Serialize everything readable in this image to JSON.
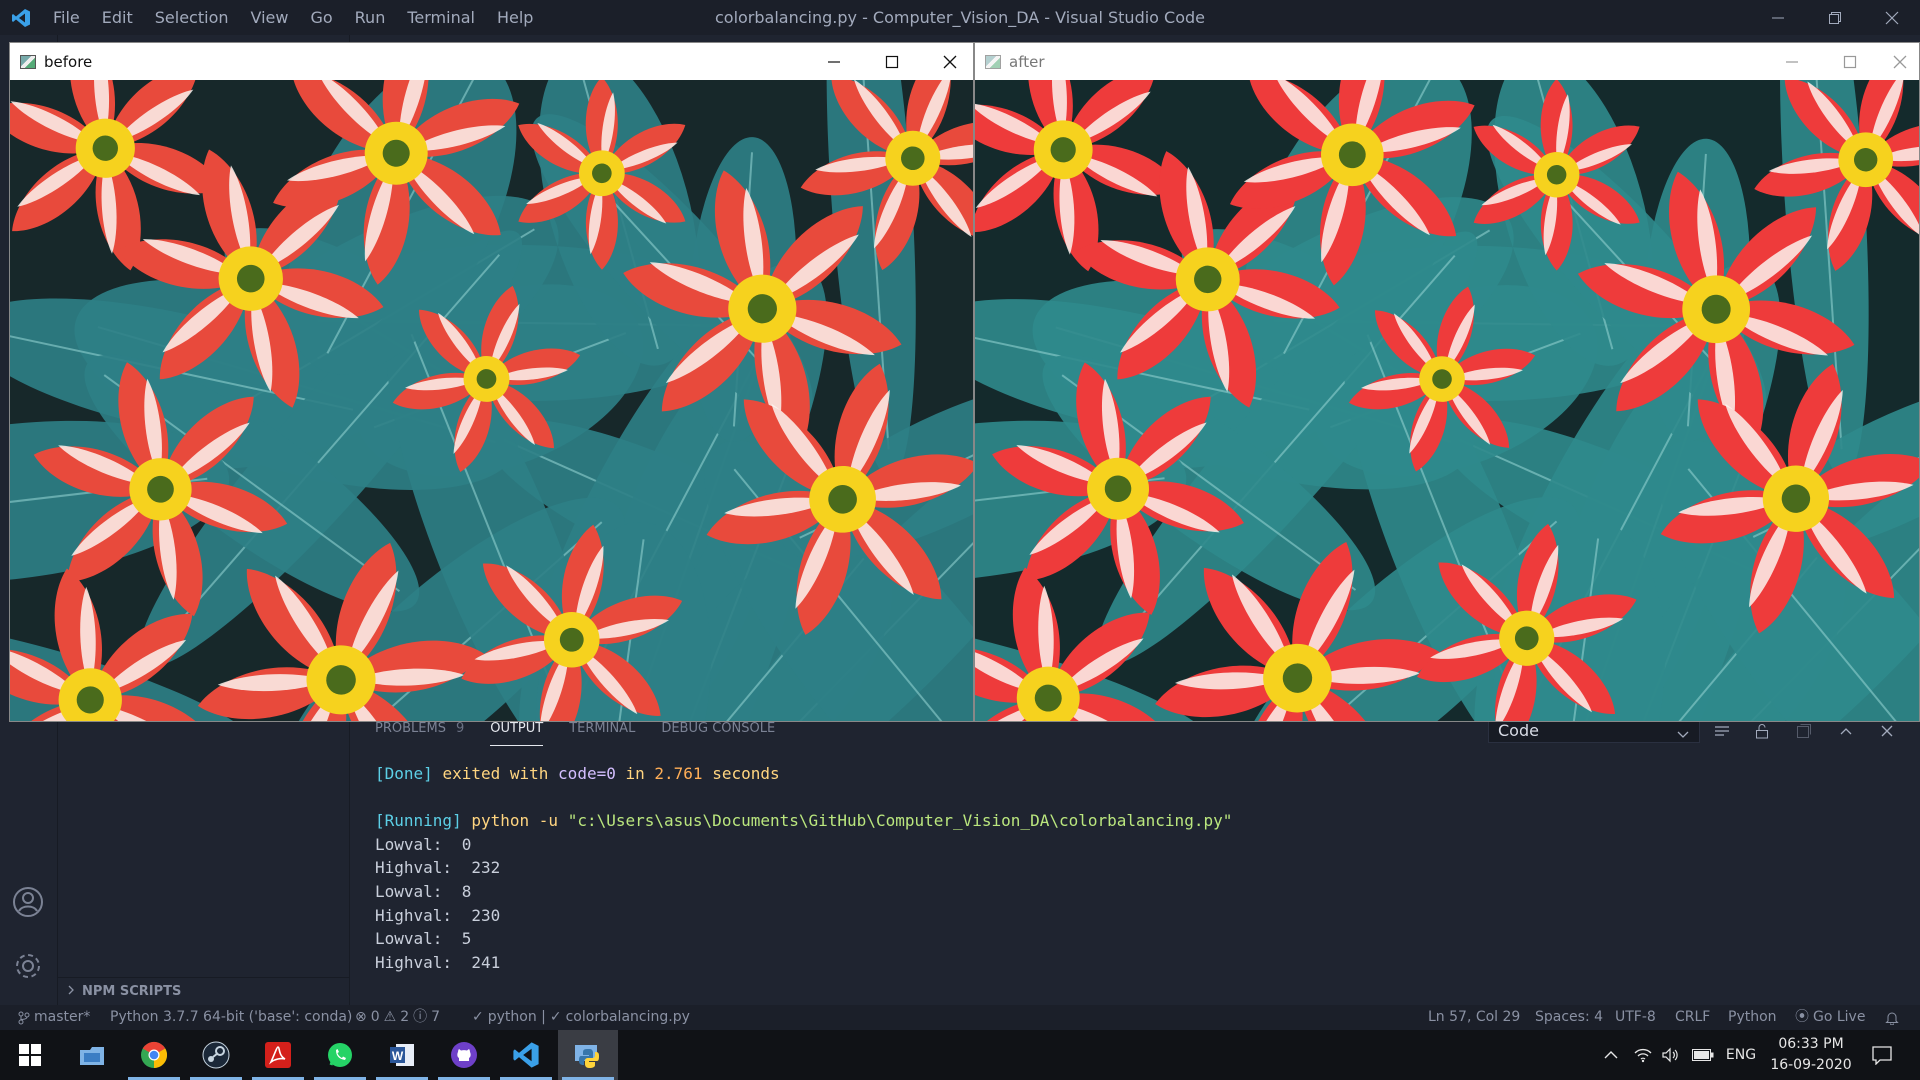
{
  "titlebar": {
    "menu": [
      "File",
      "Edit",
      "Selection",
      "View",
      "Go",
      "Run",
      "Terminal",
      "Help"
    ],
    "title": "colorbalancing.py - Computer_Vision_DA - Visual Studio Code"
  },
  "windows": {
    "before": {
      "title": "before"
    },
    "after": {
      "title": "after"
    }
  },
  "sidebar": {
    "npm_scripts": "NPM SCRIPTS"
  },
  "panel": {
    "tabs": [
      {
        "label": "PROBLEMS",
        "badge": "9"
      },
      {
        "label": "OUTPUT"
      },
      {
        "label": "TERMINAL"
      },
      {
        "label": "DEBUG CONSOLE"
      }
    ],
    "output_channel": "Code",
    "output": {
      "done_tag": "[Done]",
      "done_text": "exited with",
      "done_code": "code=0",
      "done_in": "in",
      "done_time": "2.761",
      "done_unit": "seconds",
      "running_tag": "[Running]",
      "running_cmd": "python -u",
      "running_path": "\"c:\\Users\\asus\\Documents\\GitHub\\Computer_Vision_DA\\colorbalancing.py\"",
      "lines": [
        {
          "label": "Lowval:",
          "value": "0"
        },
        {
          "label": "Highval:",
          "value": "232"
        },
        {
          "label": "Lowval:",
          "value": "8"
        },
        {
          "label": "Highval:",
          "value": "230"
        },
        {
          "label": "Lowval:",
          "value": "5"
        },
        {
          "label": "Highval:",
          "value": "241"
        }
      ]
    }
  },
  "statusbar": {
    "branch": "master*",
    "interpreter": "Python 3.7.7 64-bit ('base': conda)",
    "errors": "0",
    "warnings": "2",
    "infos": "7",
    "check1": "python |",
    "check2": "colorbalancing.py",
    "position": "Ln 57, Col 29",
    "spaces": "Spaces: 4",
    "encoding": "UTF-8",
    "eol": "CRLF",
    "language": "Python",
    "golive": "Go Live"
  },
  "taskbar": {
    "apps": [
      "start-icon",
      "file-explorer-icon",
      "chrome-icon",
      "steam-icon",
      "acrobat-icon",
      "whatsapp-icon",
      "word-icon",
      "github-desktop-icon",
      "vscode-icon",
      "python-icon"
    ],
    "language": "ENG",
    "time": "06:33 PM",
    "date": "16-09-2020"
  },
  "colors": {
    "editor_bg": "#1f2430",
    "accent_blue": "#5ccfe6",
    "string_green": "#bae67e",
    "number_orange": "#ffae57",
    "keyword_purple": "#d4bfff"
  }
}
